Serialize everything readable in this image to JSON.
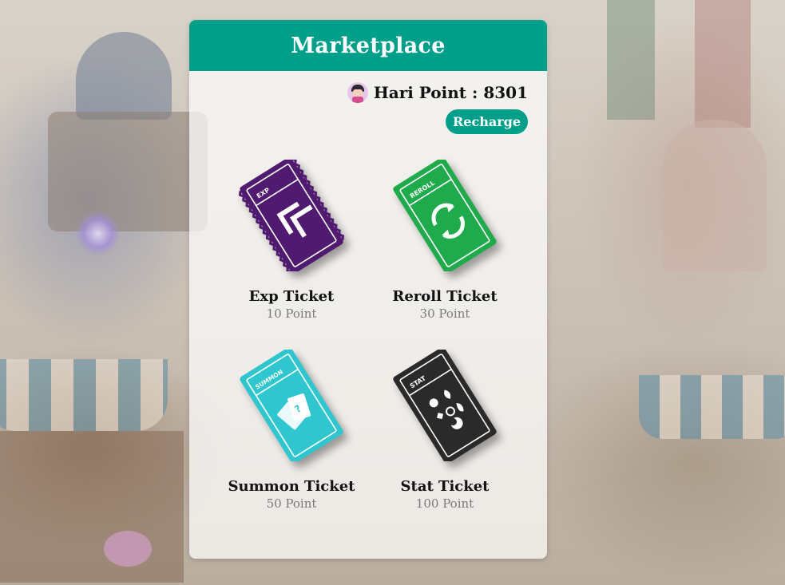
{
  "header": {
    "title": "Marketplace"
  },
  "points": {
    "label": "Hari Point : 8301",
    "avatar_icon": "avatar-icon"
  },
  "recharge": {
    "label": "Recharge"
  },
  "colors": {
    "accent": "#009f8a"
  },
  "items": [
    {
      "name": "Exp Ticket",
      "price": "10 Point",
      "ticket_tag": "EXP",
      "color": "#4f1a6f",
      "icon": "double-chevron-icon"
    },
    {
      "name": "Reroll Ticket",
      "price": "30 Point",
      "ticket_tag": "REROLL",
      "color": "#1faa4b",
      "icon": "refresh-icon"
    },
    {
      "name": "Summon Ticket",
      "price": "50 Point",
      "ticket_tag": "SUMMON",
      "color": "#2fc6cf",
      "icon": "cards-icon"
    },
    {
      "name": "Stat Ticket",
      "price": "100 Point",
      "ticket_tag": "STAT",
      "color": "#2a2a2a",
      "icon": "elements-icon"
    }
  ]
}
